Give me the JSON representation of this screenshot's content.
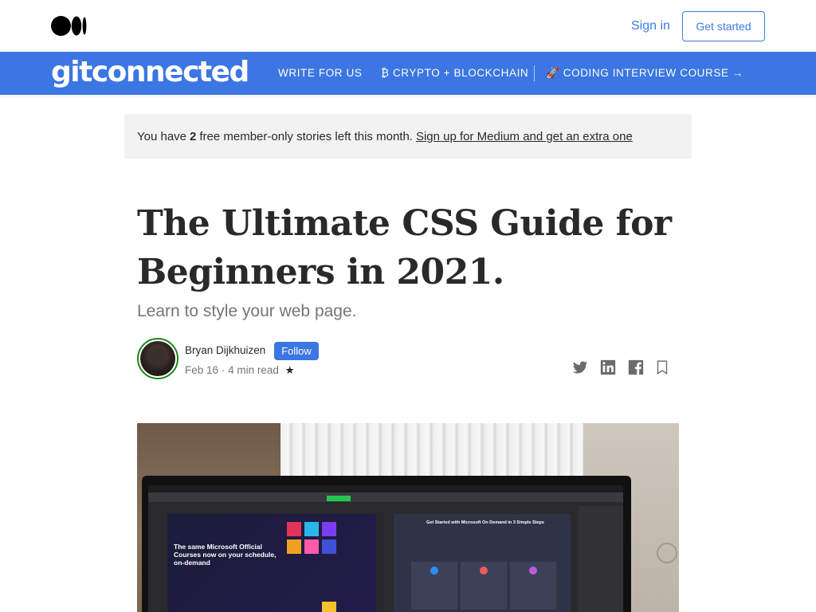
{
  "header": {
    "signin_label": "Sign in",
    "getstarted_label": "Get started"
  },
  "publication": {
    "name": "gitconnected",
    "nav": [
      {
        "label": "WRITE FOR US"
      },
      {
        "label": "₿ CRYPTO + BLOCKCHAIN"
      },
      {
        "label": "🚀 CODING INTERVIEW COURSE →"
      }
    ]
  },
  "banner": {
    "prefix": "You have",
    "count": "2",
    "suffix": "free member-only stories left this month.",
    "link": "Sign up for Medium and get an extra one"
  },
  "article": {
    "title": "The Ultimate CSS Guide for Beginners in 2021.",
    "subtitle": "Learn to style your web page.",
    "author": "Bryan Dijkhuizen",
    "follow_label": "Follow",
    "date": "Feb 16",
    "read_time": "4 min read",
    "member_star": "★"
  },
  "share": {
    "icons": [
      "twitter-icon",
      "linkedin-icon",
      "facebook-icon",
      "bookmark-icon"
    ]
  },
  "hero": {
    "screen_heading": "The same Microsoft Official Courses now on your schedule, on-demand",
    "screen_right_heading": "Get Started with Microsoft On Demand in 3 Simple Steps"
  },
  "colors": {
    "accent": "#3b76e2",
    "follow_ring": "#1a8917",
    "banner_bg": "#f2f2f2"
  }
}
